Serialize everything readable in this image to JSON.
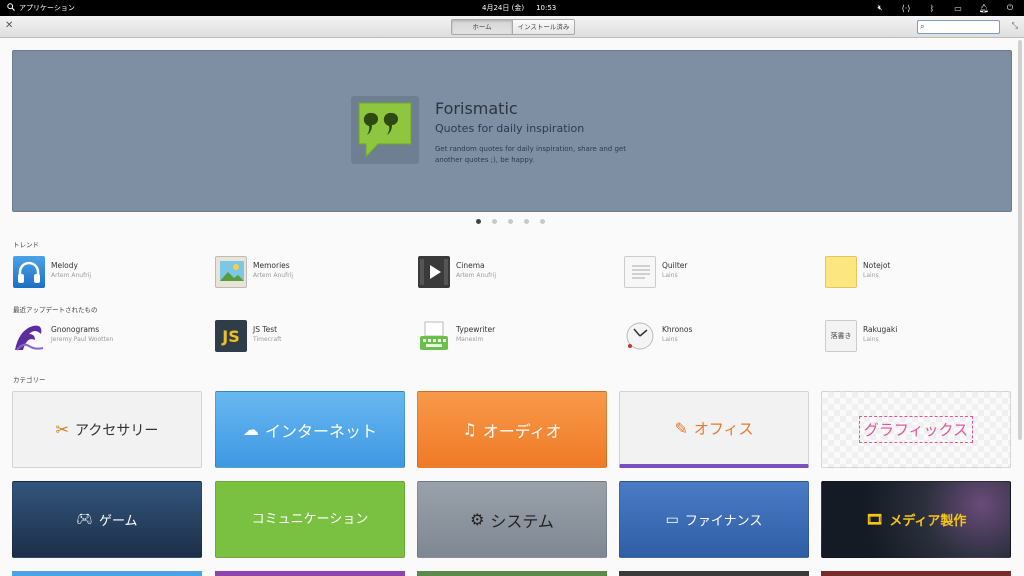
{
  "panel": {
    "applications_label": "アプリケーション",
    "date": "4月24日 (金)",
    "time": "10:53"
  },
  "header": {
    "tabs": [
      "ホーム",
      "インストール済み"
    ],
    "search_placeholder": ""
  },
  "banner": {
    "title": "Forismatic",
    "summary": "Quotes for daily inspiration",
    "description": "Get random quotes for daily inspiration, share and get another quotes ;), be happy.",
    "background": "#7e8fa3",
    "pages": 5,
    "current_page": 1
  },
  "trending": {
    "title": "トレンド",
    "apps": [
      {
        "name": "Melody",
        "author": "Artem Anufrij"
      },
      {
        "name": "Memories",
        "author": "Artem Anufrij"
      },
      {
        "name": "Cinema",
        "author": "Artem Anufrij"
      },
      {
        "name": "Quilter",
        "author": "Lains"
      },
      {
        "name": "Notejot",
        "author": "Lains"
      }
    ]
  },
  "recent": {
    "title": "最近アップデートされたもの",
    "apps": [
      {
        "name": "Gnonograms",
        "author": "Jeremy Paul Wootten"
      },
      {
        "name": "JS Test",
        "author": "Timecraft"
      },
      {
        "name": "Typewriter",
        "author": "Manexim"
      },
      {
        "name": "Khronos",
        "author": "Lains"
      },
      {
        "name": "Rakugaki",
        "author": "Lains",
        "icon_text": "落書き"
      }
    ]
  },
  "categories": {
    "title": "カテゴリー",
    "items": [
      {
        "label": "アクセサリー",
        "icon": "scissors-icon",
        "color": "#f2f2f2"
      },
      {
        "label": "インターネット",
        "icon": "cloud-icon",
        "color": "#5aabe9"
      },
      {
        "label": "オーディオ",
        "icon": "music-note-icon",
        "color": "#f38a3a"
      },
      {
        "label": "オフィス",
        "icon": "pencil-icon",
        "color": "#f2f2f2"
      },
      {
        "label": "グラフィックス",
        "icon": "",
        "color": "#f5f5f5"
      },
      {
        "label": "ゲーム",
        "icon": "gamepad-icon",
        "color": "#274262"
      },
      {
        "label": "コミュニケーション",
        "icon": "",
        "color": "#7ac142"
      },
      {
        "label": "システム",
        "icon": "gear-icon",
        "color": "#8a949e"
      },
      {
        "label": "ファイナンス",
        "icon": "credit-card-icon",
        "color": "#3d6db5"
      },
      {
        "label": "メディア製作",
        "icon": "film-icon",
        "color": "#1b2430"
      }
    ]
  }
}
